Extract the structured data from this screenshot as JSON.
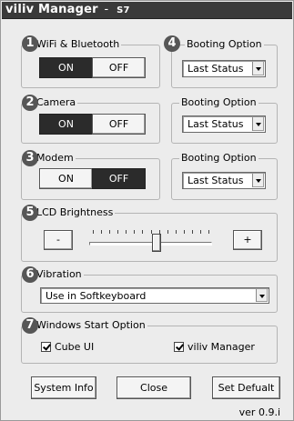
{
  "window": {
    "title": "viliv Manager",
    "title_sep": "-",
    "model": "S7"
  },
  "sections": [
    {
      "number": "1",
      "label": "WiFi & Bluetooth",
      "on_label": "ON",
      "off_label": "OFF",
      "state": "ON",
      "booting": {
        "number": "4",
        "label": "Booting Option",
        "value": "Last Status"
      }
    },
    {
      "number": "2",
      "label": "Camera",
      "on_label": "ON",
      "off_label": "OFF",
      "state": "ON",
      "booting": {
        "label": "Booting Option",
        "value": "Last Status"
      }
    },
    {
      "number": "3",
      "label": "Modem",
      "on_label": "ON",
      "off_label": "OFF",
      "state": "OFF",
      "booting": {
        "label": "Booting Option",
        "value": "Last Status"
      }
    }
  ],
  "lcd": {
    "number": "5",
    "label": "LCD Brightness",
    "minus": "-",
    "plus": "+",
    "level": 0.55
  },
  "vibration": {
    "number": "6",
    "label": "Vibration",
    "value": "Use in Softkeyboard"
  },
  "startup": {
    "number": "7",
    "label": "Windows Start Option",
    "options": [
      {
        "label": "Cube UI",
        "checked": true
      },
      {
        "label": "viliv Manager",
        "checked": true
      }
    ]
  },
  "footer": {
    "system_info": "System Info",
    "close": "Close",
    "set_default": "Set Defualt",
    "version": "ver 0.9.i"
  },
  "colors": {
    "active_toggle": "#2b2b2b",
    "badge": "#565656",
    "titlebar": "#3a3a3a"
  }
}
